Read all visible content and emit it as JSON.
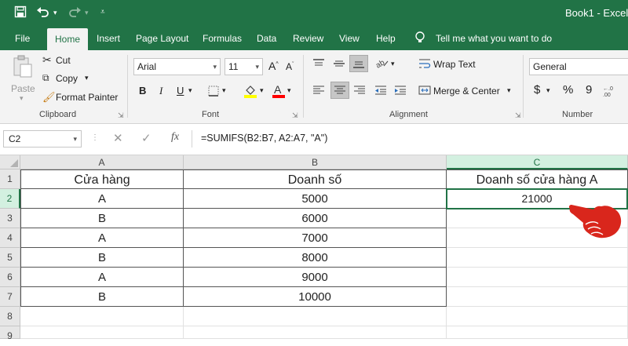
{
  "title_bar": {
    "window_title": "Book1 - Excel",
    "quick_access": [
      "save-icon",
      "undo-icon",
      "undo-dropdown-icon",
      "redo-icon",
      "redo-dropdown-icon",
      "customize-icon"
    ]
  },
  "ribbon_tabs": [
    {
      "label": "File",
      "active": false
    },
    {
      "label": "Home",
      "active": true
    },
    {
      "label": "Insert",
      "active": false
    },
    {
      "label": "Page Layout",
      "active": false
    },
    {
      "label": "Formulas",
      "active": false
    },
    {
      "label": "Data",
      "active": false
    },
    {
      "label": "Review",
      "active": false
    },
    {
      "label": "View",
      "active": false
    },
    {
      "label": "Help",
      "active": false
    }
  ],
  "tell_me": "Tell me what you want to do",
  "clipboard": {
    "paste": "Paste",
    "cut": "Cut",
    "copy": "Copy",
    "format_painter": "Format Painter",
    "group_label": "Clipboard"
  },
  "font": {
    "name": "Arial",
    "size": "11",
    "bold": "B",
    "italic": "I",
    "underline": "U",
    "group_label": "Font",
    "fill_color": "#ffff00",
    "font_color": "#ff0000"
  },
  "alignment": {
    "wrap_text": "Wrap Text",
    "merge_center": "Merge & Center",
    "group_label": "Alignment"
  },
  "number": {
    "format": "General",
    "currency": "$",
    "percent": "%",
    "comma": "9",
    "group_label": "Number"
  },
  "formula_bar": {
    "name_box": "C2",
    "fx": "fx",
    "formula": "=SUMIFS(B2:B7, A2:A7, \"A\")"
  },
  "sheet": {
    "columns": [
      "A",
      "B",
      "C"
    ],
    "rows": [
      "1",
      "2",
      "3",
      "4",
      "5",
      "6",
      "7",
      "8",
      "9"
    ],
    "selected_cell": "C2",
    "cells": [
      [
        "Cửa hàng",
        "Doanh số",
        "Doanh số cửa hàng A"
      ],
      [
        "A",
        "5000",
        "21000"
      ],
      [
        "B",
        "6000",
        ""
      ],
      [
        "A",
        "7000",
        ""
      ],
      [
        "B",
        "8000",
        ""
      ],
      [
        "A",
        "9000",
        ""
      ],
      [
        "B",
        "10000",
        ""
      ],
      [
        "",
        "",
        ""
      ],
      [
        "",
        "",
        ""
      ]
    ]
  },
  "colors": {
    "excel_green": "#217346",
    "ribbon_bg": "#f3f3f3",
    "pointer_hand": "#d9261c"
  }
}
